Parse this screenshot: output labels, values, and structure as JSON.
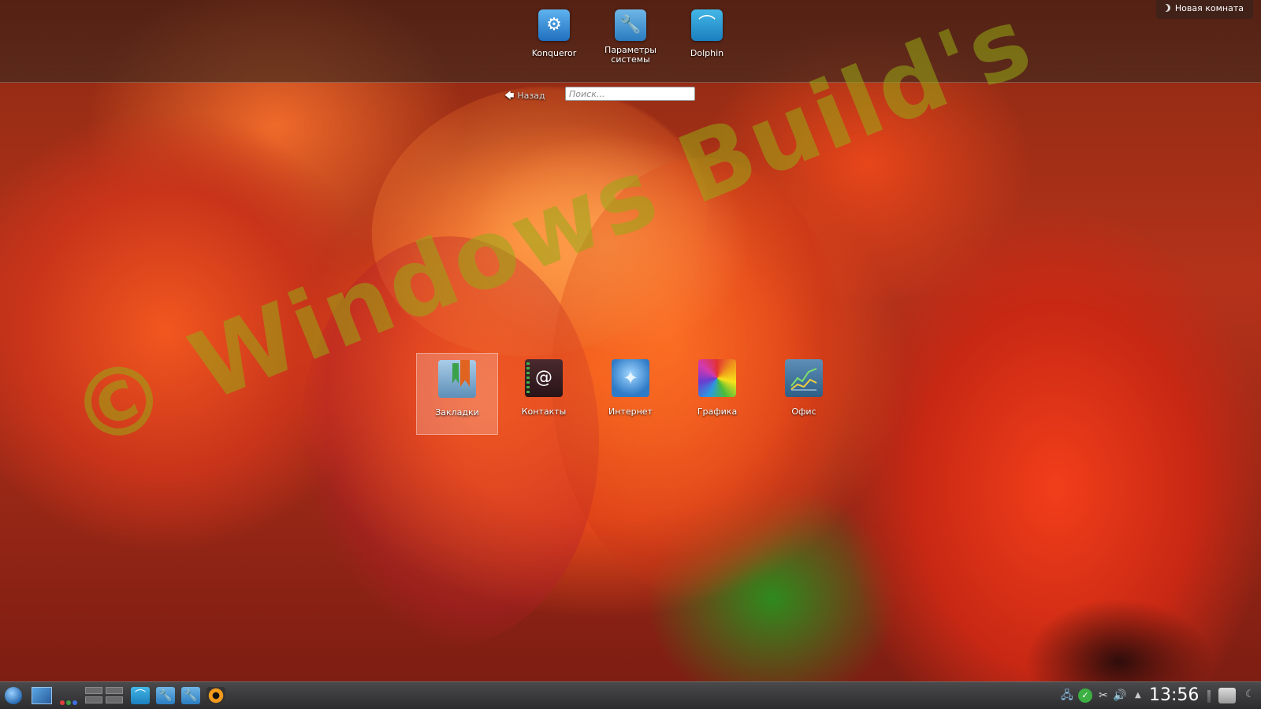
{
  "topbar": {
    "favorites": [
      {
        "label": "Konqueror",
        "icon": "konqueror-icon"
      },
      {
        "label": "Параметры системы",
        "icon": "system-settings-icon"
      },
      {
        "label": "Dolphin",
        "icon": "dolphin-icon"
      }
    ],
    "activity_label": "Новая комната"
  },
  "nav": {
    "back_label": "Назад",
    "search_placeholder": "Поиск..."
  },
  "categories": [
    {
      "label": "Закладки",
      "icon": "bookmarks-icon",
      "selected": true
    },
    {
      "label": "Контакты",
      "icon": "contacts-icon"
    },
    {
      "label": "Интернет",
      "icon": "internet-icon"
    },
    {
      "label": "Графика",
      "icon": "graphics-icon"
    },
    {
      "label": "Офис",
      "icon": "office-icon"
    }
  ],
  "watermark": "© Windows Build's",
  "taskbar": {
    "clock": "13:56",
    "launchers": [
      "kickoff-icon",
      "show-desktop-icon",
      "activities-icon",
      "pager-icon",
      "dolphin-icon",
      "system-settings-icon",
      "system-settings-icon",
      "camera-icon"
    ],
    "tray": [
      "network-icon",
      "updates-ok-icon",
      "clipboard-icon",
      "volume-icon",
      "expand-tray-icon",
      "battery-icon",
      "kwallet-icon",
      "activity-manager-icon"
    ]
  },
  "colors": {
    "accent": "#2a7cc0",
    "panel": "#2c2c2e",
    "watermark": "#96aa14"
  }
}
